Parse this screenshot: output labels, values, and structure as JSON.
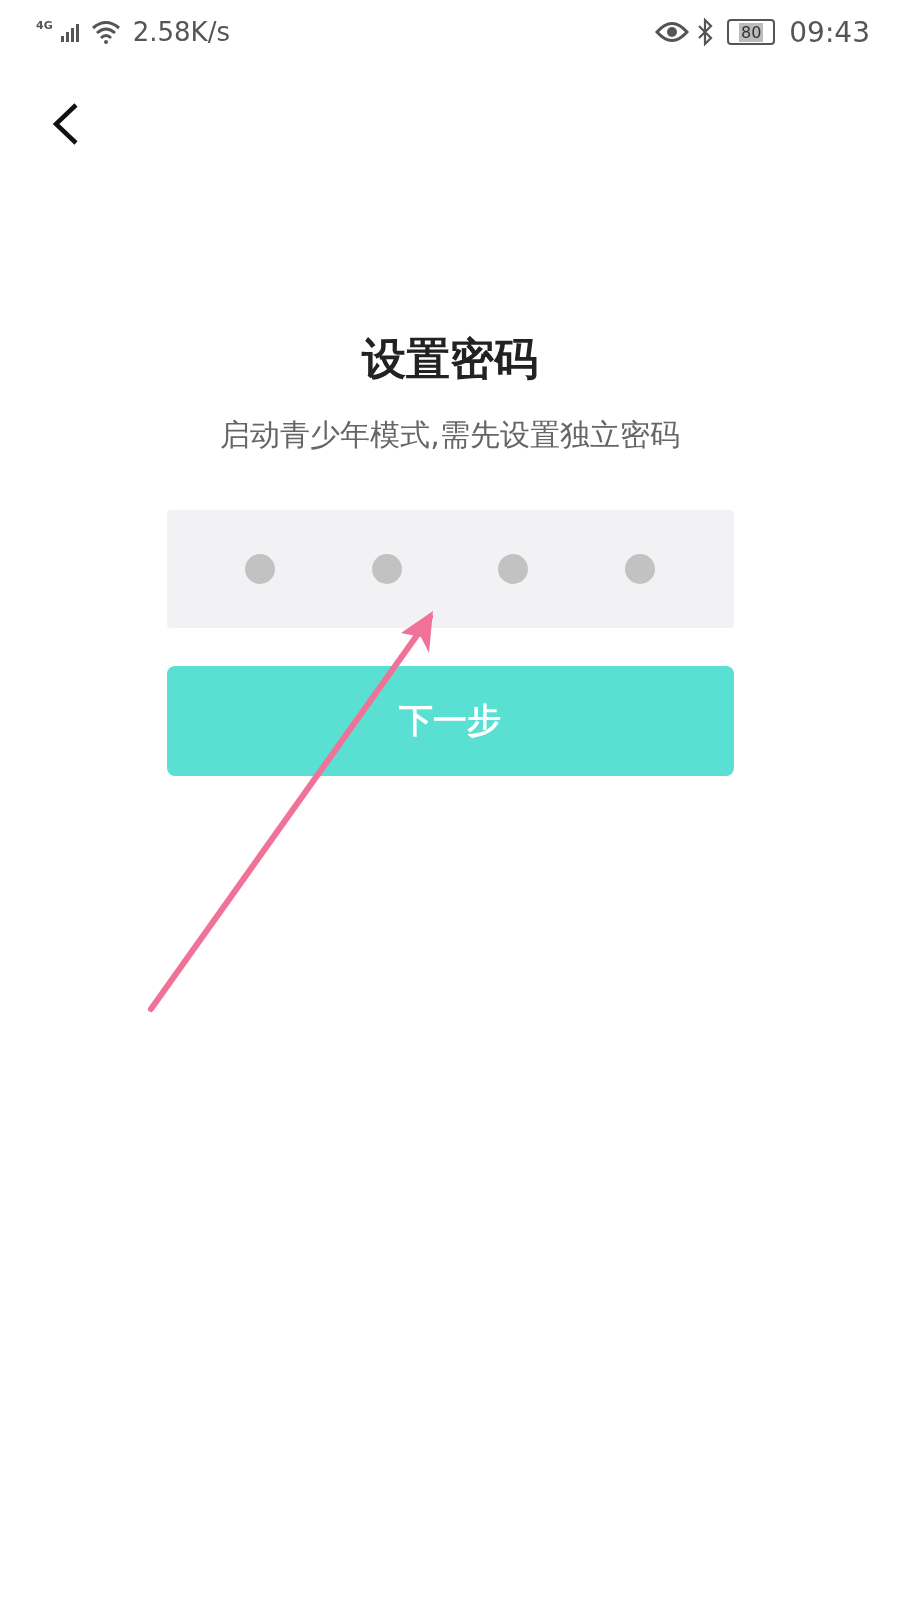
{
  "status_bar": {
    "network": "4G",
    "speed": "2.58K/s",
    "battery": "80",
    "time": "09:43"
  },
  "title": "设置密码",
  "subtitle": "启动青少年模式,需先设置独立密码",
  "pin": [
    {
      "filled": false
    },
    {
      "filled": false
    },
    {
      "filled": false
    },
    {
      "filled": false
    }
  ],
  "next_button": {
    "label": "下一步",
    "disabled": false
  }
}
